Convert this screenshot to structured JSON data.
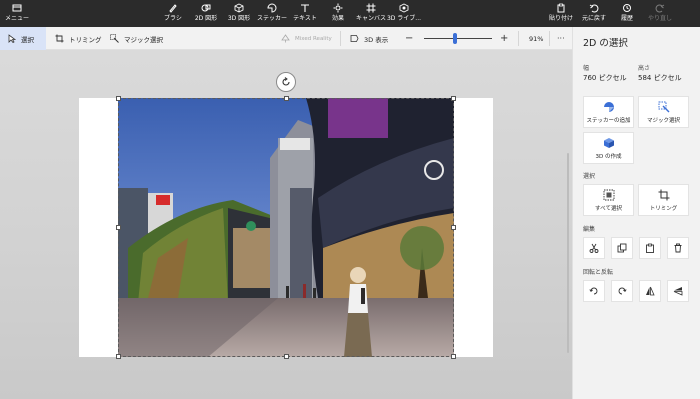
{
  "top_toolbar": {
    "menu": "メニュー",
    "brush": "ブラシ",
    "shapes_2d": "2D 図形",
    "shapes_3d": "3D 図形",
    "stickers": "ステッカー",
    "text": "テキスト",
    "effects": "効果",
    "canvas": "キャンバス",
    "library_3d": "3D ライブ...",
    "paste": "貼り付け",
    "undo": "元に戻す",
    "history": "履歴",
    "redo": "やり直し"
  },
  "sub_toolbar": {
    "select": "選択",
    "crop": "トリミング",
    "magic_select": "マジック選択",
    "mixed_reality": "Mixed Reality",
    "view_3d": "3D 表示",
    "zoom_level": "91%",
    "zoom_fraction": 0.45,
    "more": "···"
  },
  "panel": {
    "title": "2D の選択",
    "width_label": "幅",
    "width_value": "760 ピクセル",
    "height_label": "高さ",
    "height_value": "584 ピクセル",
    "make_sticker": "ステッカーの追加",
    "magic_select": "マジック選択",
    "make_3d": "3D の作成",
    "select_section": "選択",
    "select_all": "すべて選択",
    "crop": "トリミング",
    "edit_section": "編集",
    "rotate_flip_section": "回転と反転"
  },
  "colors": {
    "topbar": "#2b2b2b",
    "accent": "#3b6fd6",
    "panel": "#f2f2f2"
  },
  "icons": [
    "menu-icon",
    "brush-icon",
    "shapes-2d-icon",
    "shapes-3d-icon",
    "stickers-icon",
    "text-icon",
    "effects-icon",
    "canvas-icon",
    "library-3d-icon",
    "paste-icon",
    "undo-icon",
    "history-icon",
    "redo-icon",
    "select-icon",
    "crop-icon",
    "magic-select-icon",
    "mixed-reality-icon",
    "view-3d-icon",
    "zoom-out-icon",
    "zoom-in-icon",
    "rotate-handle-icon",
    "sticker-icon",
    "cube-icon",
    "select-all-icon",
    "cut-icon",
    "copy-icon",
    "paste-edit-icon",
    "delete-icon",
    "rotate-left-icon",
    "rotate-right-icon",
    "flip-vertical-icon",
    "flip-horizontal-icon"
  ]
}
